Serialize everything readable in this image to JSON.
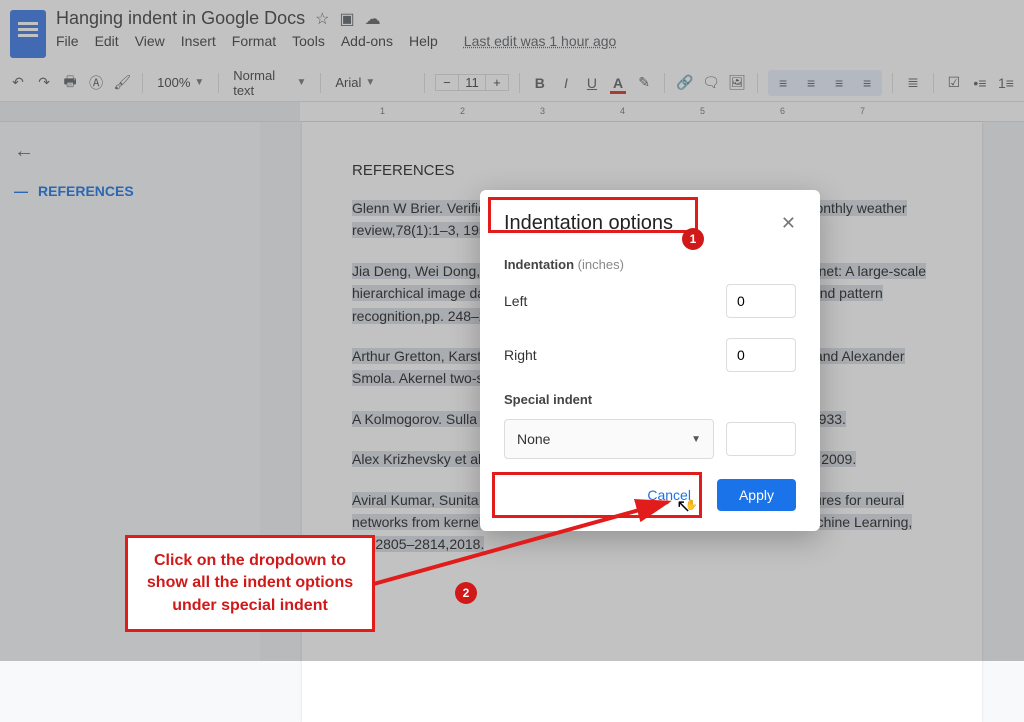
{
  "header": {
    "doc_title": "Hanging indent in Google Docs",
    "last_edit": "Last edit was 1 hour ago",
    "menus": [
      "File",
      "Edit",
      "View",
      "Insert",
      "Format",
      "Tools",
      "Add-ons",
      "Help"
    ]
  },
  "toolbar": {
    "zoom": "100%",
    "style": "Normal text",
    "font": "Arial",
    "font_size": "11"
  },
  "ruler": {
    "ticks": [
      "1",
      "2",
      "3",
      "4",
      "5",
      "6",
      "7"
    ]
  },
  "outline": {
    "item": "REFERENCES"
  },
  "document": {
    "heading": "REFERENCES",
    "refs": [
      "Glenn W Brier. Verification of forecasts expressed in terms of probability. Monthly weather review,78(1):1–3, 1950.",
      "Jia Deng, Wei Dong, Richard Socher, Li-Jia Li, Kai Li, and Li Fei-Fei. Imagenet: A large-scale hierarchical image database. In2009 IEEE conference on computer vision and pattern recognition,pp. 248–255. Ieee, 2009.",
      "Arthur Gretton, Karsten M Borgwardt, Malte J Rasch, Bernhard Schölkopf, and Alexander Smola. Akernel two-sample test. 2012.",
      "A Kolmogorov. Sulla determinazione empirica di una lgge di distribuzione. 1933.",
      "Alex Krizhevsky et al. Learning multiple layers of features from tiny images. 2009.",
      "Aviral Kumar, Sunita Sarawagi, and Ujjwal Jain. Trainable calibration measures for neural networks from kernel mean embeddings. InInternational Conference on Machine Learning, pp. 2805–2814,2018."
    ]
  },
  "dialog": {
    "title": "Indentation options",
    "section": "Indentation",
    "section_unit": "(inches)",
    "left_label": "Left",
    "left_value": "0",
    "right_label": "Right",
    "right_value": "0",
    "special_label": "Special indent",
    "special_value": "None",
    "special_amount": "",
    "cancel": "Cancel",
    "apply": "Apply"
  },
  "annotation": {
    "badge1": "1",
    "badge2": "2",
    "callout": "Click on the dropdown to show all the indent options under special indent"
  }
}
